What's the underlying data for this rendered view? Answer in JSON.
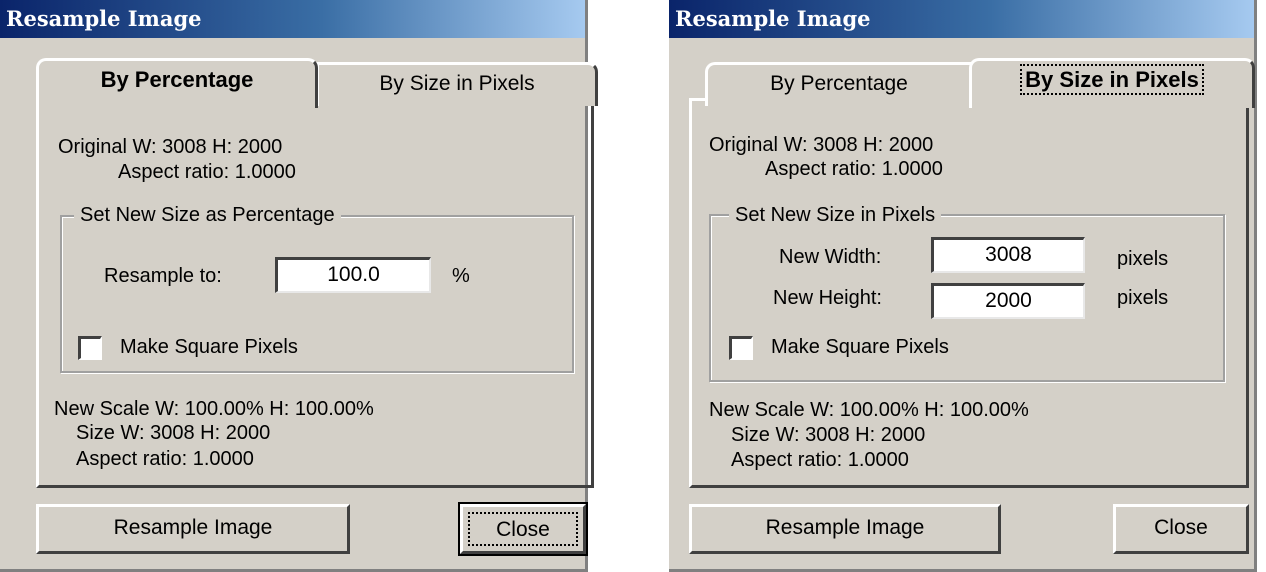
{
  "dialogs": [
    {
      "title": "Resample Image",
      "tabs": [
        "By Percentage",
        "By Size in Pixels"
      ],
      "active_tab": "By Percentage",
      "original": {
        "line1": "Original W: 3008  H: 2000",
        "line2": "Aspect ratio: 1.0000"
      },
      "group_title": "Set New Size as Percentage",
      "resample_label": "Resample to:",
      "resample_value": "100.0",
      "resample_unit": "%",
      "checkbox_label": "Make Square Pixels",
      "checkbox_checked": false,
      "result": {
        "line1": "New Scale  W: 100.00% H: 100.00%",
        "line2": "Size   W: 3008  H: 2000",
        "line3": "Aspect ratio: 1.0000"
      },
      "buttons": {
        "resample": "Resample Image",
        "close": "Close"
      }
    },
    {
      "title": "Resample Image",
      "tabs": [
        "By Percentage",
        "By Size in Pixels"
      ],
      "active_tab": "By Size in Pixels",
      "original": {
        "line1": "Original W: 3008  H: 2000",
        "line2": "Aspect ratio: 1.0000"
      },
      "group_title": "Set New Size in Pixels",
      "width_label": "New Width:",
      "width_value": "3008",
      "width_unit": "pixels",
      "height_label": "New Height:",
      "height_value": "2000",
      "height_unit": "pixels",
      "checkbox_label": "Make Square Pixels",
      "checkbox_checked": false,
      "result": {
        "line1": "New Scale  W: 100.00% H: 100.00%",
        "line2": "Size   W: 3008  H: 2000",
        "line3": "Aspect ratio: 1.0000"
      },
      "buttons": {
        "resample": "Resample Image",
        "close": "Close"
      }
    }
  ]
}
